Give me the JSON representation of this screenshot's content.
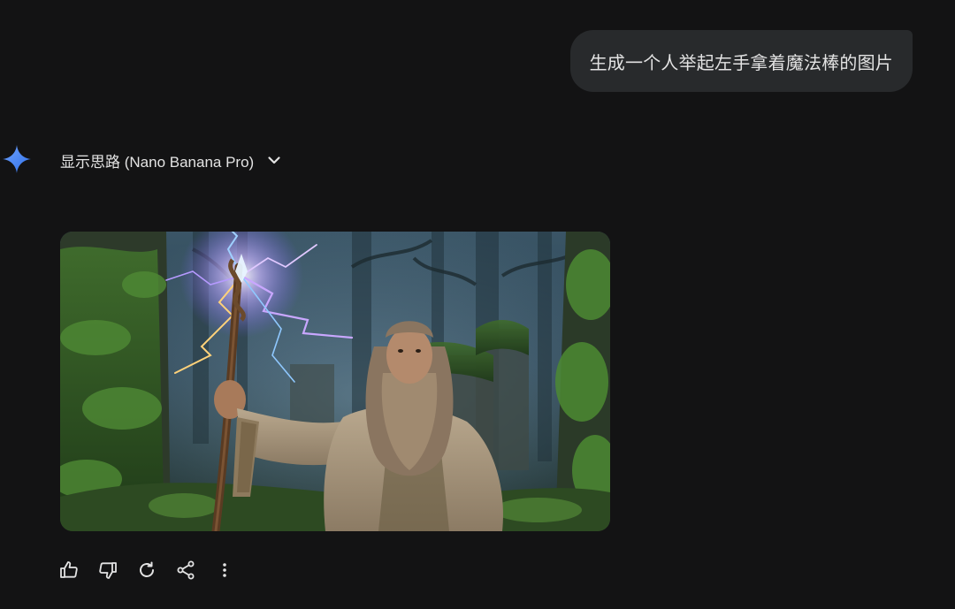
{
  "user_message": {
    "text": "生成一个人举起左手拿着魔法棒的图片"
  },
  "model_response": {
    "thoughts_toggle_label": "显示思路 (Nano Banana Pro)",
    "image": {
      "icon": "generated-image"
    }
  },
  "actions": [
    {
      "icon": "thumbs-up-icon"
    },
    {
      "icon": "thumbs-down-icon"
    },
    {
      "icon": "regenerate-icon"
    },
    {
      "icon": "share-icon"
    },
    {
      "icon": "more-vert-icon"
    }
  ],
  "colors": {
    "background": "#131314",
    "bubble": "#282a2c",
    "text": "#e3e3e3",
    "spark_blue": "#4f8df5"
  }
}
